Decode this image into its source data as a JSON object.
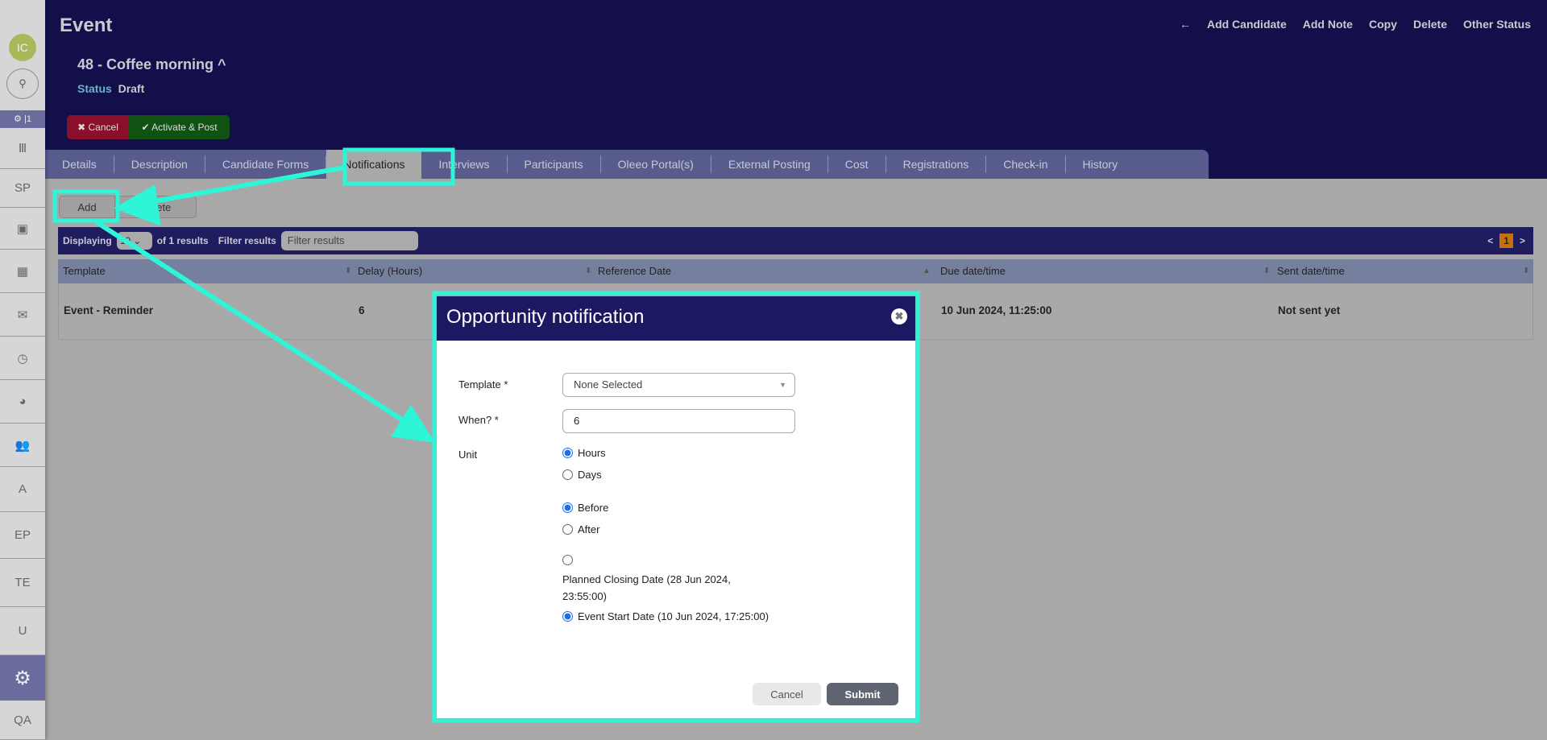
{
  "sidebar": {
    "avatar": "IC",
    "gear_badge": "⚙ |1",
    "items": [
      {
        "label": "Ⅲ",
        "name": "institution"
      },
      {
        "label": "SP",
        "name": "sp"
      },
      {
        "label": "▣",
        "name": "calendar-star"
      },
      {
        "label": "▦",
        "name": "calendar"
      },
      {
        "label": "✉",
        "name": "mail"
      },
      {
        "label": "◷",
        "name": "clock"
      },
      {
        "label": "◕",
        "name": "pie-chart"
      },
      {
        "label": "👥",
        "name": "users"
      },
      {
        "label": "A",
        "name": "a"
      },
      {
        "label": "EP",
        "name": "ep"
      },
      {
        "label": "TE",
        "name": "te"
      },
      {
        "label": "U",
        "name": "u"
      },
      {
        "label": "⚙",
        "name": "settings"
      },
      {
        "label": "QA",
        "name": "qa"
      }
    ]
  },
  "header": {
    "title": "Event",
    "record": "48 - Coffee morning ^",
    "status_label": "Status",
    "status_value": "Draft",
    "actions": [
      "←",
      "Add Candidate",
      "Add Note",
      "Copy",
      "Delete",
      "Other Status"
    ],
    "cancel": "✖ Cancel",
    "activate": "✔ Activate & Post"
  },
  "tabs": [
    "Details",
    "Description",
    "Candidate Forms",
    "Notifications",
    "Interviews",
    "Participants",
    "Oleeo Portal(s)",
    "External Posting",
    "Cost",
    "Registrations",
    "Check-in",
    "History"
  ],
  "toolbar": {
    "add": "Add",
    "delete": "Delete",
    "displaying": "Displaying",
    "page_size": "10",
    "of_results": "of 1 results",
    "filter_label": "Filter results",
    "filter_placeholder": "Filter results",
    "prev": "<",
    "page": "1",
    "next": ">"
  },
  "table": {
    "columns": [
      "Template",
      "Delay (Hours)",
      "Reference Date",
      "Due date/time",
      "Sent date/time"
    ],
    "rows": [
      [
        "Event - Reminder",
        "6",
        "",
        "10 Jun 2024, 11:25:00",
        "Not sent yet"
      ]
    ]
  },
  "modal": {
    "title": "Opportunity notification",
    "close": "✖",
    "template_label": "Template *",
    "template_value": "None Selected",
    "when_label": "When? *",
    "when_value": "6",
    "unit_label": "Unit",
    "hours": "Hours",
    "days": "Days",
    "before": "Before",
    "after": "After",
    "planned": "Planned Closing Date (28 Jun 2024, 23:55:00)",
    "event_start": "Event Start Date (10 Jun 2024, 17:25:00)",
    "cancel": "Cancel",
    "submit": "Submit"
  },
  "colors": {
    "highlight": "#2ff5d8",
    "header": "#120f4a"
  }
}
